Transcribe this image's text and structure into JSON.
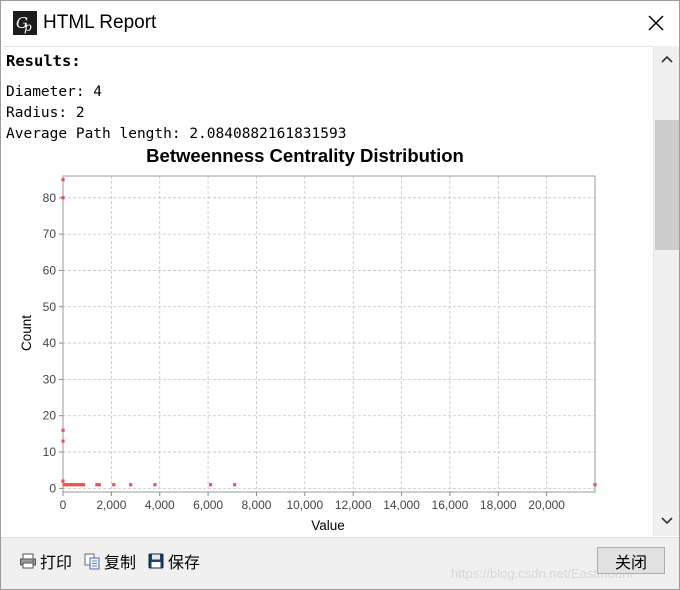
{
  "window": {
    "title": "HTML Report",
    "icon": "gephi-logo-icon"
  },
  "report": {
    "heading": "Results:",
    "diameter": "Diameter: 4",
    "radius": "Radius: 2",
    "average_path_length": "Average Path length: 2.0840882161831593"
  },
  "chart_data": {
    "type": "scatter",
    "title": "Betweenness Centrality Distribution",
    "xlabel": "Value",
    "ylabel": "Count",
    "xlim": [
      0,
      22000
    ],
    "ylim": [
      -1,
      86
    ],
    "x_ticks": [
      0,
      2000,
      4000,
      6000,
      8000,
      10000,
      12000,
      14000,
      16000,
      18000,
      20000
    ],
    "x_tick_labels": [
      "0",
      "2,000",
      "4,000",
      "6,000",
      "8,000",
      "10,000",
      "12,000",
      "14,000",
      "16,000",
      "18,000",
      "20,000"
    ],
    "y_ticks": [
      0,
      10,
      20,
      30,
      40,
      50,
      60,
      70,
      80
    ],
    "y_tick_labels": [
      "0",
      "10",
      "20",
      "30",
      "40",
      "50",
      "60",
      "70",
      "80"
    ],
    "grid": true,
    "point_color": "#e8524f",
    "series": [
      {
        "x": [
          0,
          0,
          0,
          0,
          0,
          50,
          150,
          250,
          350,
          450,
          550,
          650,
          750,
          850,
          1400,
          1500,
          2100,
          2800,
          3800,
          6100,
          7100,
          22000
        ],
        "y": [
          85,
          80,
          16,
          13,
          2,
          1,
          1,
          1,
          1,
          1,
          1,
          1,
          1,
          1,
          1,
          1,
          1,
          1,
          1,
          1,
          1,
          1
        ]
      }
    ]
  },
  "toolbar": {
    "print_label": "打印",
    "copy_label": "复制",
    "save_label": "保存",
    "close_label": "关闭"
  },
  "watermark": "https://blog.csdn.net/Eastmount"
}
